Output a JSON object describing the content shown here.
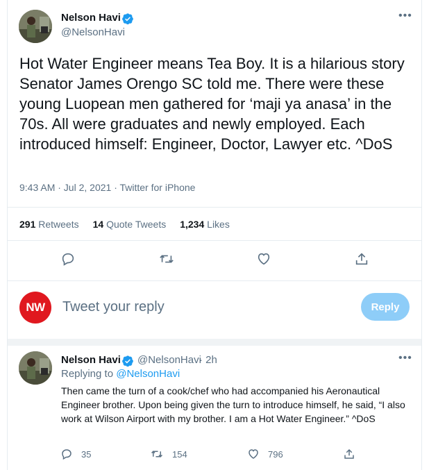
{
  "main_tweet": {
    "author_name": "Nelson Havi",
    "author_handle": "@NelsonHavi",
    "text": "Hot Water Engineer means Tea Boy. It is a hilarious story Senator James Orengo SC told me. There were these young Luopean men gathered for ‘maji ya anasa’ in the 70s. All were graduates and newly employed. Each introduced himself: Engineer, Doctor, Lawyer etc. ^DoS",
    "meta": "9:43 AM · Jul 2, 2021 · Twitter for iPhone",
    "stats": {
      "retweets_count": "291",
      "retweets_label": "Retweets",
      "quotes_count": "14",
      "quotes_label": "Quote Tweets",
      "likes_count": "1,234",
      "likes_label": "Likes"
    }
  },
  "reply_composer": {
    "avatar_text": "NW",
    "placeholder": "Tweet your reply",
    "button_label": "Reply"
  },
  "reply_tweet": {
    "author_name": "Nelson Havi",
    "author_handle": "@NelsonHavi",
    "time": "· 2h",
    "replying_prefix": "Replying to",
    "replying_handle": "@NelsonHavi",
    "text": "Then came the turn of a cook/chef who had accompanied his Aeronautical Engineer brother. Upon being given the turn to introduce himself, he said, “I also work at Wilson Airport with my brother. I am a Hot Water Engineer.” ^DoS",
    "reply_count": "35",
    "retweet_count": "154",
    "like_count": "796"
  },
  "colors": {
    "accent": "#1d9bf0",
    "reply_button": "#8ecdf8",
    "nw_avatar": "#e0181f",
    "secondary_text": "#5b7083"
  },
  "icons": [
    "verified-badge-icon",
    "more-icon",
    "reply-icon",
    "retweet-icon",
    "like-icon",
    "share-icon"
  ]
}
